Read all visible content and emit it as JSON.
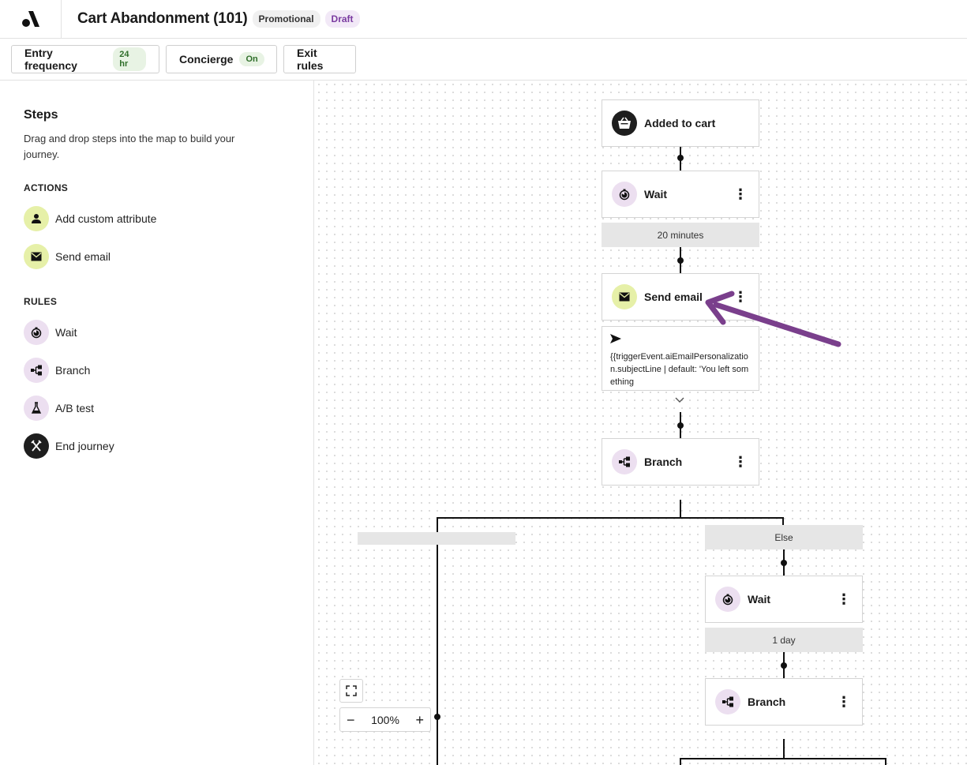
{
  "header": {
    "title": "Cart Abandonment (101)",
    "tags": [
      "Promotional",
      "Draft"
    ]
  },
  "toolbar": {
    "entry_frequency": {
      "label": "Entry frequency",
      "value": "24 hr"
    },
    "concierge": {
      "label": "Concierge",
      "value": "On"
    },
    "exit_rules": "Exit rules"
  },
  "sidebar": {
    "title": "Steps",
    "description": "Drag and drop steps into the map to build your journey.",
    "actions_heading": "ACTIONS",
    "actions": [
      "Add custom attribute",
      "Send email"
    ],
    "rules_heading": "RULES",
    "rules": [
      "Wait",
      "Branch",
      "A/B test",
      "End journey"
    ]
  },
  "canvas": {
    "trigger": "Added to cart",
    "wait1": {
      "label": "Wait",
      "duration": "20 minutes"
    },
    "send_email": {
      "label": "Send email",
      "preview": "{{triggerEvent.aiEmailPersonalization.subjectLine | default: 'You left something"
    },
    "branch1": "Branch",
    "else_label": "Else",
    "wait2": {
      "label": "Wait",
      "duration": "1 day"
    },
    "branch2": "Branch",
    "zoom": "100%"
  },
  "colors": {
    "accent_purple": "#7a3f8c",
    "green_pill_bg": "#e8f3e4",
    "icon_green": "#e6f0a8",
    "icon_purple": "#ecdff0"
  }
}
